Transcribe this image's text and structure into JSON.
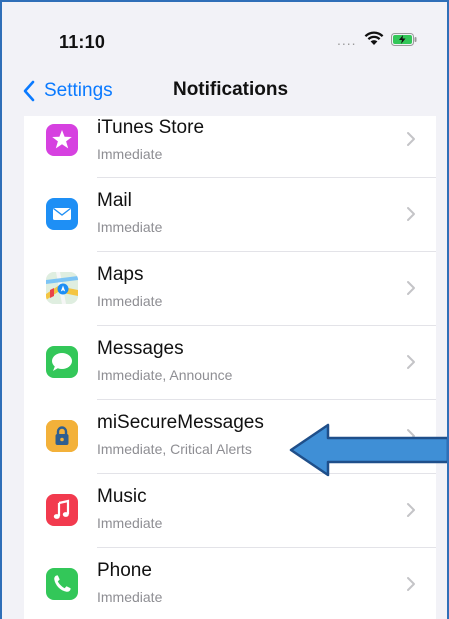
{
  "status_bar": {
    "time": "11:10",
    "signal": "....",
    "wifi_icon": "wifi-icon",
    "battery_icon": "battery-charging-icon"
  },
  "nav": {
    "back_label": "Settings",
    "title": "Notifications"
  },
  "apps": [
    {
      "name": "iTunes Store",
      "detail": "Immediate",
      "icon": "star-icon",
      "color": "#d641e0"
    },
    {
      "name": "Mail",
      "detail": "Immediate",
      "icon": "envelope-icon",
      "color": "#1e8ff5"
    },
    {
      "name": "Maps",
      "detail": "Immediate",
      "icon": "map-icon",
      "color": "#e9f0ea"
    },
    {
      "name": "Messages",
      "detail": "Immediate, Announce",
      "icon": "speech-bubble-icon",
      "color": "#33c759"
    },
    {
      "name": "miSecureMessages",
      "detail": "Immediate, Critical Alerts",
      "icon": "lock-icon",
      "color": "#f3b13a"
    },
    {
      "name": "Music",
      "detail": "Immediate",
      "icon": "music-note-icon",
      "color": "#f23a4e"
    },
    {
      "name": "Phone",
      "detail": "Immediate",
      "icon": "phone-icon",
      "color": "#33c759"
    }
  ],
  "annotation": {
    "arrow_color": "#3f8fd6",
    "arrow_outline": "#1f4f8a"
  }
}
